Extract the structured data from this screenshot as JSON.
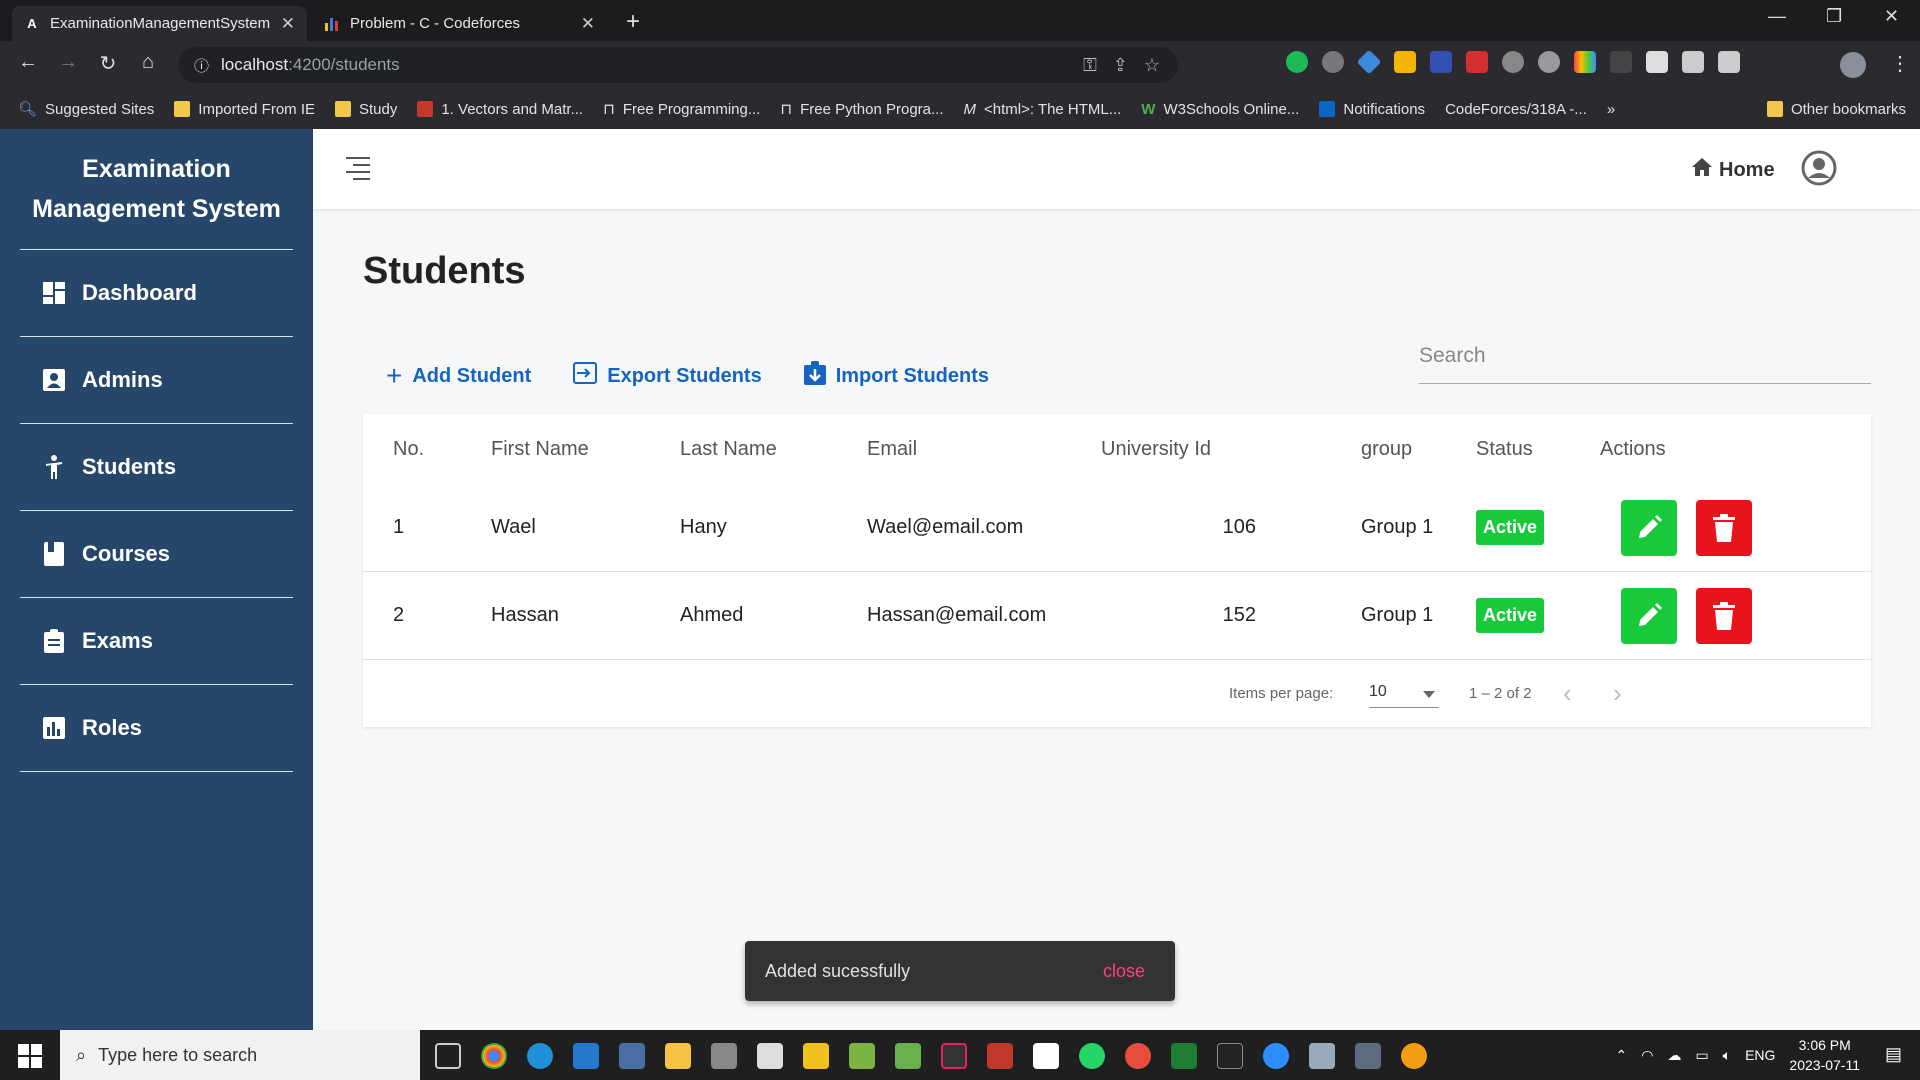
{
  "browser": {
    "tabs": [
      {
        "title": "ExaminationManagementSystem",
        "active": true,
        "favicon": "A"
      },
      {
        "title": "Problem - C - Codeforces",
        "active": false,
        "favicon": "bars-icon"
      }
    ],
    "url_host": "localhost",
    "url_path": ":4200/students",
    "bookmarks": [
      "Suggested Sites",
      "Imported From IE",
      "Study",
      "1. Vectors and Matr...",
      "Free Programming...",
      "Free Python Progra...",
      "<html>: The HTML...",
      "W3Schools Online...",
      "Notifications",
      "CodeForces/318A -..."
    ],
    "other_bookmarks": "Other bookmarks"
  },
  "sidebar": {
    "brand": [
      "Examination",
      "Management System"
    ],
    "items": [
      {
        "label": "Dashboard",
        "icon": "dashboard-icon"
      },
      {
        "label": "Admins",
        "icon": "admin-icon"
      },
      {
        "label": "Students",
        "icon": "student-icon"
      },
      {
        "label": "Courses",
        "icon": "book-icon"
      },
      {
        "label": "Exams",
        "icon": "clipboard-icon"
      },
      {
        "label": "Roles",
        "icon": "chart-icon"
      }
    ]
  },
  "appbar": {
    "home_label": "Home"
  },
  "page": {
    "title": "Students",
    "actions": {
      "add": "Add Student",
      "export": "Export Students",
      "import": "Import Students"
    },
    "search_placeholder": "Search",
    "table": {
      "headers": [
        "No.",
        "First Name",
        "Last Name",
        "Email",
        "University Id",
        "group",
        "Status",
        "Actions"
      ],
      "rows": [
        {
          "no": "1",
          "first": "Wael",
          "last": "Hany",
          "email": "Wael@email.com",
          "uid": "106",
          "group": "Group 1",
          "status": "Active"
        },
        {
          "no": "2",
          "first": "Hassan",
          "last": "Ahmed",
          "email": "Hassan@email.com",
          "uid": "152",
          "group": "Group 1",
          "status": "Active"
        }
      ]
    },
    "paginator": {
      "label": "Items per page:",
      "page_size": "10",
      "range": "1 – 2 of 2"
    }
  },
  "snackbar": {
    "message": "Added sucessfully",
    "action": "close"
  },
  "taskbar": {
    "search_placeholder": "Type here to search",
    "language": "ENG",
    "time": "3:06 PM",
    "date": "2023-07-11"
  },
  "colors": {
    "sidebar": "#26466a",
    "accent": "#1565c0",
    "active_badge": "#18c93a",
    "delete": "#e8131b"
  }
}
